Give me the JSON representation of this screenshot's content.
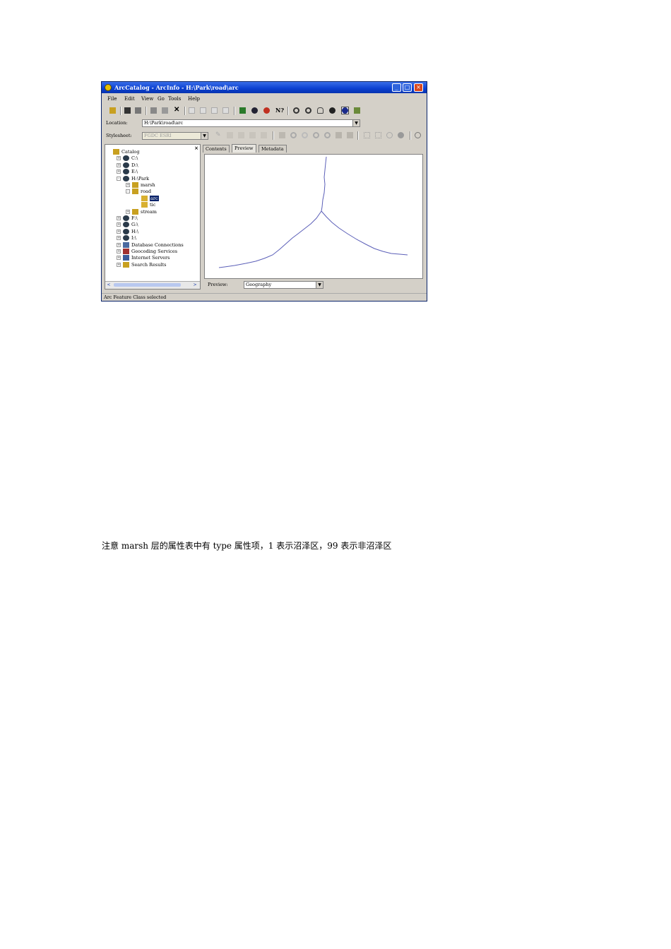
{
  "window": {
    "title": "ArcCatalog - ArcInfo - H:\\Park\\road\\arc"
  },
  "menu": [
    "File",
    "Edit",
    "View",
    "Go",
    "Tools",
    "Help"
  ],
  "location": {
    "label": "Location:",
    "value": "H:\\Park\\road\\arc"
  },
  "stylesheet": {
    "label": "Stylesheet:",
    "value": "FGDC ESRI"
  },
  "tree": {
    "items": [
      {
        "label": "Catalog",
        "depth": 0,
        "expander": "",
        "icon": "catalog-icon"
      },
      {
        "label": "C:\\",
        "depth": 1,
        "expander": "+",
        "icon": "drive-icon"
      },
      {
        "label": "D:\\",
        "depth": 1,
        "expander": "+",
        "icon": "drive-icon"
      },
      {
        "label": "E:\\",
        "depth": 1,
        "expander": "+",
        "icon": "drive-icon"
      },
      {
        "label": "H:\\Park",
        "depth": 1,
        "expander": "-",
        "icon": "drive-icon"
      },
      {
        "label": "marsh",
        "depth": 2,
        "expander": "+",
        "icon": "coverage-icon"
      },
      {
        "label": "road",
        "depth": 2,
        "expander": "-",
        "icon": "coverage-icon"
      },
      {
        "label": "arc",
        "depth": 3,
        "expander": "",
        "icon": "feature-class-icon",
        "selected": true
      },
      {
        "label": "tic",
        "depth": 3,
        "expander": "",
        "icon": "feature-class-icon"
      },
      {
        "label": "stream",
        "depth": 2,
        "expander": "+",
        "icon": "coverage-icon"
      },
      {
        "label": "F:\\",
        "depth": 1,
        "expander": "+",
        "icon": "drive-icon"
      },
      {
        "label": "G:\\",
        "depth": 1,
        "expander": "+",
        "icon": "drive-icon"
      },
      {
        "label": "H:\\",
        "depth": 1,
        "expander": "+",
        "icon": "drive-icon"
      },
      {
        "label": "I:\\",
        "depth": 1,
        "expander": "+",
        "icon": "drive-icon"
      },
      {
        "label": "Database Connections",
        "depth": 1,
        "expander": "+",
        "icon": "database-icon"
      },
      {
        "label": "Geocoding Services",
        "depth": 1,
        "expander": "+",
        "icon": "geocoding-icon"
      },
      {
        "label": "Internet Servers",
        "depth": 1,
        "expander": "+",
        "icon": "server-icon"
      },
      {
        "label": "Search Results",
        "depth": 1,
        "expander": "+",
        "icon": "search-results-icon"
      }
    ]
  },
  "tabs": [
    "Contents",
    "Preview",
    "Metadata"
  ],
  "active_tab": "Preview",
  "preview": {
    "label": "Preview:",
    "value": "Geography"
  },
  "status": "Arc Feature Class selected",
  "caption": "注意 marsh 层的属性表中有 type 属性项，1 表示沼泽区，99 表示非沼泽区",
  "colors": {
    "titlebar": "#0a3fd0",
    "arc_line": "#5b5fb8",
    "selection": "#0a246a"
  }
}
